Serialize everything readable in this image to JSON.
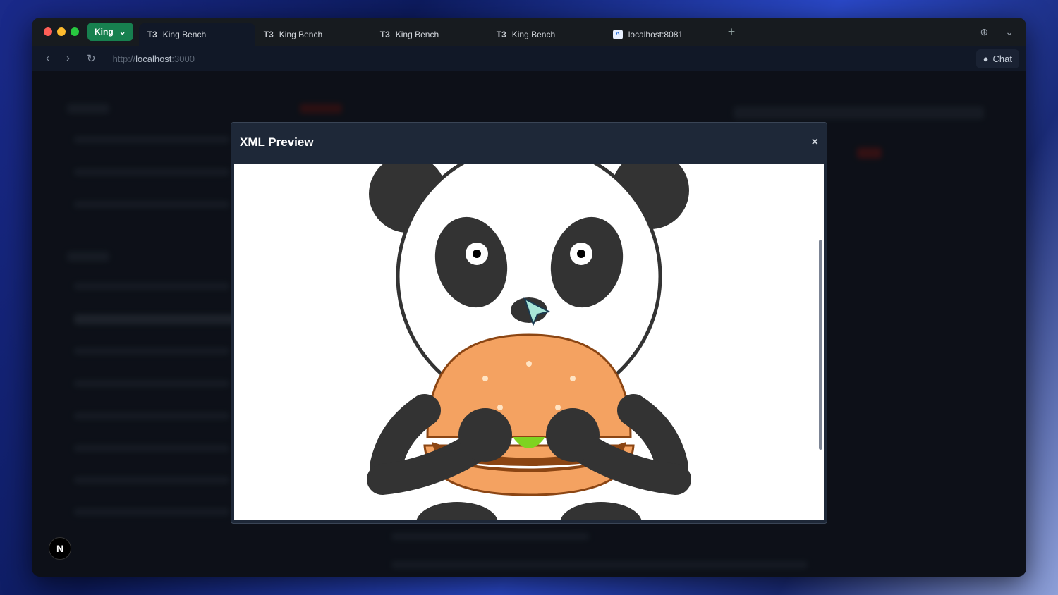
{
  "browser": {
    "profile": "King",
    "tabs": [
      {
        "label": "King Bench",
        "icon": "T3",
        "active": true
      },
      {
        "label": "King Bench",
        "icon": "T3"
      },
      {
        "label": "King Bench",
        "icon": "T3"
      },
      {
        "label": "King Bench",
        "icon": "T3"
      },
      {
        "label": "localhost:8081",
        "icon": "expo-icon"
      }
    ],
    "url_scheme": "http://",
    "url_host": "localhost",
    "url_port": ":3000",
    "chat_label": "Chat"
  },
  "modal": {
    "title": "XML Preview",
    "close": "×"
  },
  "colors": {
    "accent": "#17804f",
    "bun": "#f4a261",
    "lettuce": "#7ed321",
    "panda_dark": "#333333"
  },
  "dev_badge": "N"
}
